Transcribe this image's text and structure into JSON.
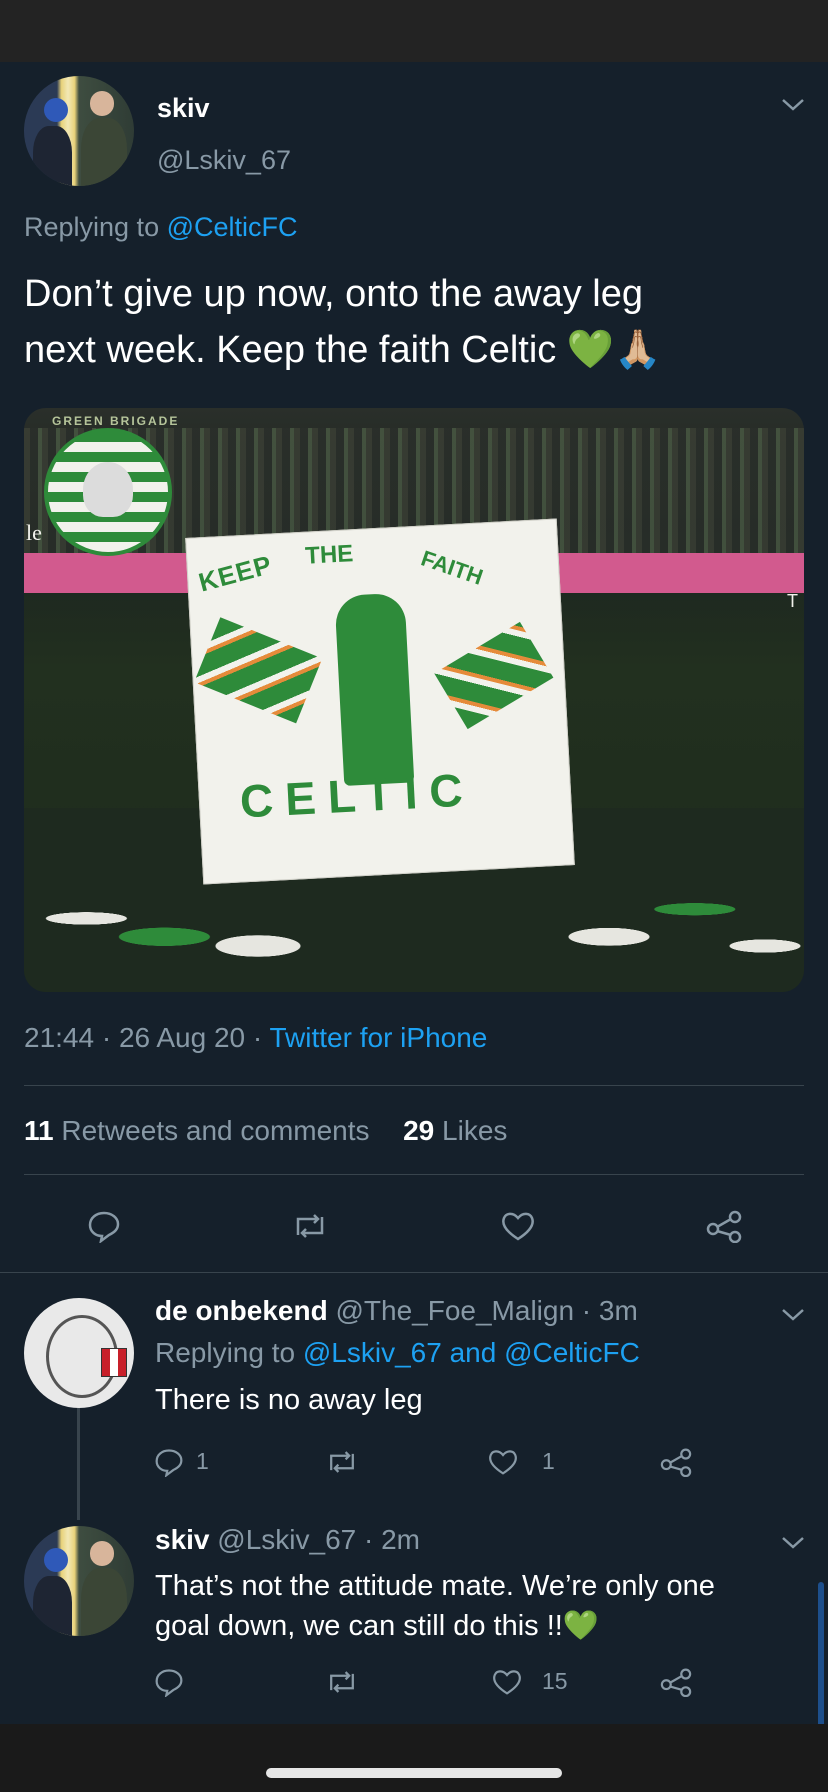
{
  "main_tweet": {
    "name": "skiv",
    "handle": "@Lskiv_67",
    "replying_prefix": "Replying to",
    "replying_to": "@CelticFC",
    "text_line1": "Don’t give up now, onto the away leg",
    "text_line2": "next week. Keep the faith Celtic 💚🙏🏼",
    "media": {
      "banner_words": [
        "KEEP",
        "THE",
        "FAITH",
        "CELTIC"
      ],
      "logo_text": "GREEN BRIGADE",
      "sign_left": "le",
      "sign_right": "T"
    },
    "time": "21:44",
    "date": "26 Aug 20",
    "source": "Twitter for iPhone",
    "retweets_count": "11",
    "retweets_label": "Retweets and comments",
    "likes_count": "29",
    "likes_label": "Likes"
  },
  "replies": [
    {
      "name": "de onbekend",
      "handle": "@The_Foe_Malign",
      "time": "3m",
      "replying_prefix": "Replying to",
      "replying_to": "@Lskiv_67 and @CelticFC",
      "text": "There is no away leg",
      "reply_count": "1",
      "like_count": "1"
    },
    {
      "name": "skiv",
      "handle": "@Lskiv_67",
      "time": "2m",
      "text_line1": "That’s not the attitude mate. We’re only one",
      "text_line2": "goal down, we can still do this !!💚",
      "like_count": "15"
    }
  ],
  "icons": {
    "reply": "reply-icon",
    "retweet": "retweet-icon",
    "like": "heart-icon",
    "share": "share-icon",
    "more": "chevron-down-icon"
  },
  "colors": {
    "background": "#15202b",
    "link": "#1da1f2",
    "muted": "#8899a6",
    "divider": "#38444d"
  }
}
